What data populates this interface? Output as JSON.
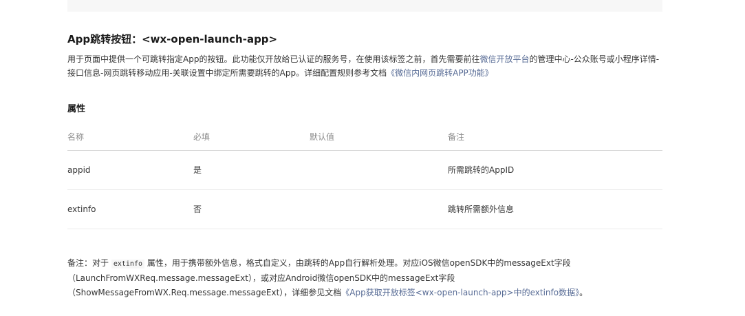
{
  "section": {
    "title": "App跳转按钮：<wx-open-launch-app>",
    "desc_part1": "用于页面中提供一个可跳转指定App的按钮。此功能仅开放给已认证的服务号，在使用该标签之前，首先需要前往",
    "desc_link1": "微信开放平台",
    "desc_part2": "的管理中心-公众账号或小程序详情-接口信息-网页跳转移动应用-关联设置中绑定所需要跳转的App。详细配置规则参考文档",
    "desc_link2": "《微信内网页跳转APP功能》"
  },
  "attributes": {
    "title": "属性",
    "headers": [
      "名称",
      "必填",
      "默认值",
      "备注"
    ],
    "rows": [
      {
        "name": "appid",
        "required": "是",
        "default": "",
        "remark": "所需跳转的AppID"
      },
      {
        "name": "extinfo",
        "required": "否",
        "default": "",
        "remark": "跳转所需额外信息"
      }
    ]
  },
  "note": {
    "prefix": "备注：对于",
    "code": "extinfo",
    "part1": "属性，用于携带额外信息，格式自定义，由跳转的App自行解析处理。对应iOS微信openSDK中的messageExt字段",
    "part2": "（LaunchFromWXReq.message.messageExt），或对应Android微信openSDK中的messageExt字段",
    "part3": "（ShowMessageFromWX.Req.message.messageExt），详细参见文档",
    "link": "《App获取开放标签<wx-open-launch-app>中的extinfo数据》",
    "suffix": "。"
  },
  "colors": {
    "link": "#576b95",
    "text": "#353535",
    "header_text": "#8a8a8a"
  }
}
